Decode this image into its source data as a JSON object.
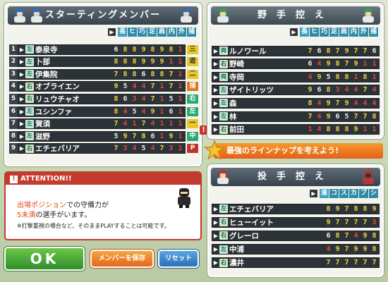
{
  "starting": {
    "title": "スターティングメンバー",
    "cols": [
      "長",
      "ヒ",
      "巧",
      "足",
      "肩",
      "内",
      "外",
      "捕"
    ],
    "rows": [
      {
        "n": "1",
        "hand": "左",
        "name": "泰泉寺",
        "stats": [
          "6",
          "8",
          "8",
          "9",
          "8",
          "9",
          "8",
          "1"
        ],
        "pos": "三",
        "posColor": "#e8c825"
      },
      {
        "n": "2",
        "hand": "左",
        "name": "卜部",
        "stats": [
          "8",
          "8",
          "8",
          "9",
          "9",
          "9",
          "1",
          "1"
        ],
        "pos": "遊",
        "posColor": "#e8c825"
      },
      {
        "n": "3",
        "hand": "左",
        "name": "伊集院",
        "stats": [
          "7",
          "8",
          "8",
          "6",
          "8",
          "8",
          "7",
          "1"
        ],
        "pos": "二",
        "posColor": "#e8c825"
      },
      {
        "n": "4",
        "hand": "右",
        "name": "オブライエン",
        "stats": [
          "9",
          "5",
          "4",
          "4",
          "7",
          "1",
          "7",
          "1"
        ],
        "pos": "捕",
        "posColor": "#e0741c"
      },
      {
        "n": "5",
        "hand": "右",
        "name": "リュウチャオ",
        "stats": [
          "8",
          "6",
          "3",
          "4",
          "7",
          "1",
          "5",
          "1"
        ],
        "pos": "右",
        "posColor": "#2aa873"
      },
      {
        "n": "6",
        "hand": "左",
        "name": "ユシンファ",
        "stats": [
          "8",
          "4",
          "5",
          "4",
          "9",
          "1",
          "6",
          "1"
        ],
        "pos": "左",
        "posColor": "#2aa873"
      },
      {
        "n": "7",
        "hand": "左",
        "name": "賀須",
        "stats": [
          "7",
          "4",
          "1",
          "7",
          "4",
          "1",
          "1",
          "1"
        ],
        "pos": "一",
        "posColor": "#e8c825"
      },
      {
        "n": "8",
        "hand": "左",
        "name": "滋野",
        "stats": [
          "5",
          "9",
          "7",
          "8",
          "6",
          "1",
          "9",
          "1"
        ],
        "pos": "中",
        "posColor": "#2aa873"
      },
      {
        "n": "9",
        "hand": "右",
        "name": "エチェバリア",
        "stats": [
          "7",
          "3",
          "4",
          "5",
          "4",
          "7",
          "3",
          "1"
        ],
        "pos": "P",
        "posColor": "#c0352b"
      }
    ]
  },
  "bench": {
    "title": "野手控え",
    "cols": [
      "長",
      "ヒ",
      "巧",
      "足",
      "肩",
      "内",
      "外",
      "捕"
    ],
    "rows": [
      {
        "hand": "両",
        "name": "ルノワール",
        "stats": [
          "7",
          "6",
          "8",
          "7",
          "9",
          "7",
          "7",
          "6"
        ]
      },
      {
        "hand": "右",
        "name": "野崎",
        "stats": [
          "6",
          "4",
          "9",
          "8",
          "7",
          "9",
          "1",
          "1"
        ]
      },
      {
        "hand": "両",
        "name": "寺岡",
        "stats": [
          "4",
          "9",
          "5",
          "8",
          "8",
          "1",
          "8",
          "1"
        ]
      },
      {
        "hand": "左",
        "name": "ザイトリッツ",
        "stats": [
          "9",
          "6",
          "8",
          "3",
          "4",
          "4",
          "7",
          "4"
        ]
      },
      {
        "hand": "左",
        "name": "森",
        "stats": [
          "8",
          "4",
          "9",
          "7",
          "9",
          "4",
          "4",
          "4"
        ]
      },
      {
        "hand": "左",
        "name": "林",
        "stats": [
          "7",
          "4",
          "9",
          "6",
          "5",
          "7",
          "7",
          "8"
        ]
      },
      {
        "hand": "右",
        "name": "前田",
        "stats": [
          "1",
          "4",
          "8",
          "8",
          "8",
          "9",
          "1",
          "1"
        ]
      }
    ]
  },
  "banner": {
    "text": "最強のラインナップを考えよう!"
  },
  "pitchers": {
    "title": "投手控え",
    "cols": [
      "速",
      "コ",
      "ス",
      "カ",
      "ブ",
      "シ"
    ],
    "rows": [
      {
        "hand": "左",
        "name": "エチェバリア",
        "stats": [
          "8",
          "9",
          "7",
          "8",
          "8",
          "9"
        ]
      },
      {
        "hand": "右",
        "name": "ヒューイット",
        "stats": [
          "9",
          "7",
          "7",
          "7",
          "7",
          "3"
        ]
      },
      {
        "hand": "右",
        "name": "グレーロ",
        "stats": [
          "6",
          "8",
          "7",
          "4",
          "9",
          "8"
        ]
      },
      {
        "hand": "左",
        "name": "中浦",
        "stats": [
          "4",
          "9",
          "7",
          "9",
          "9",
          "8"
        ]
      },
      {
        "hand": "右",
        "name": "濃井",
        "stats": [
          "7",
          "7",
          "7",
          "7",
          "7",
          "7"
        ]
      }
    ]
  },
  "attention": {
    "title": "ATTENTION!!",
    "line1a": "出場ポジション",
    "line1b": "での守備力が",
    "line2a": "5未満",
    "line2b": "の選手がいます。",
    "note": "※打撃重視の場合など、そのままPLAYすることは可能です。"
  },
  "buttons": {
    "ok": "OK",
    "save": "メンバーを保存",
    "reset": "リセット"
  },
  "colors": {
    "statHigh": "#f0d040",
    "statMid": "#e9e9e9",
    "statLow": "#e2463a",
    "accent": "#e2601a"
  }
}
